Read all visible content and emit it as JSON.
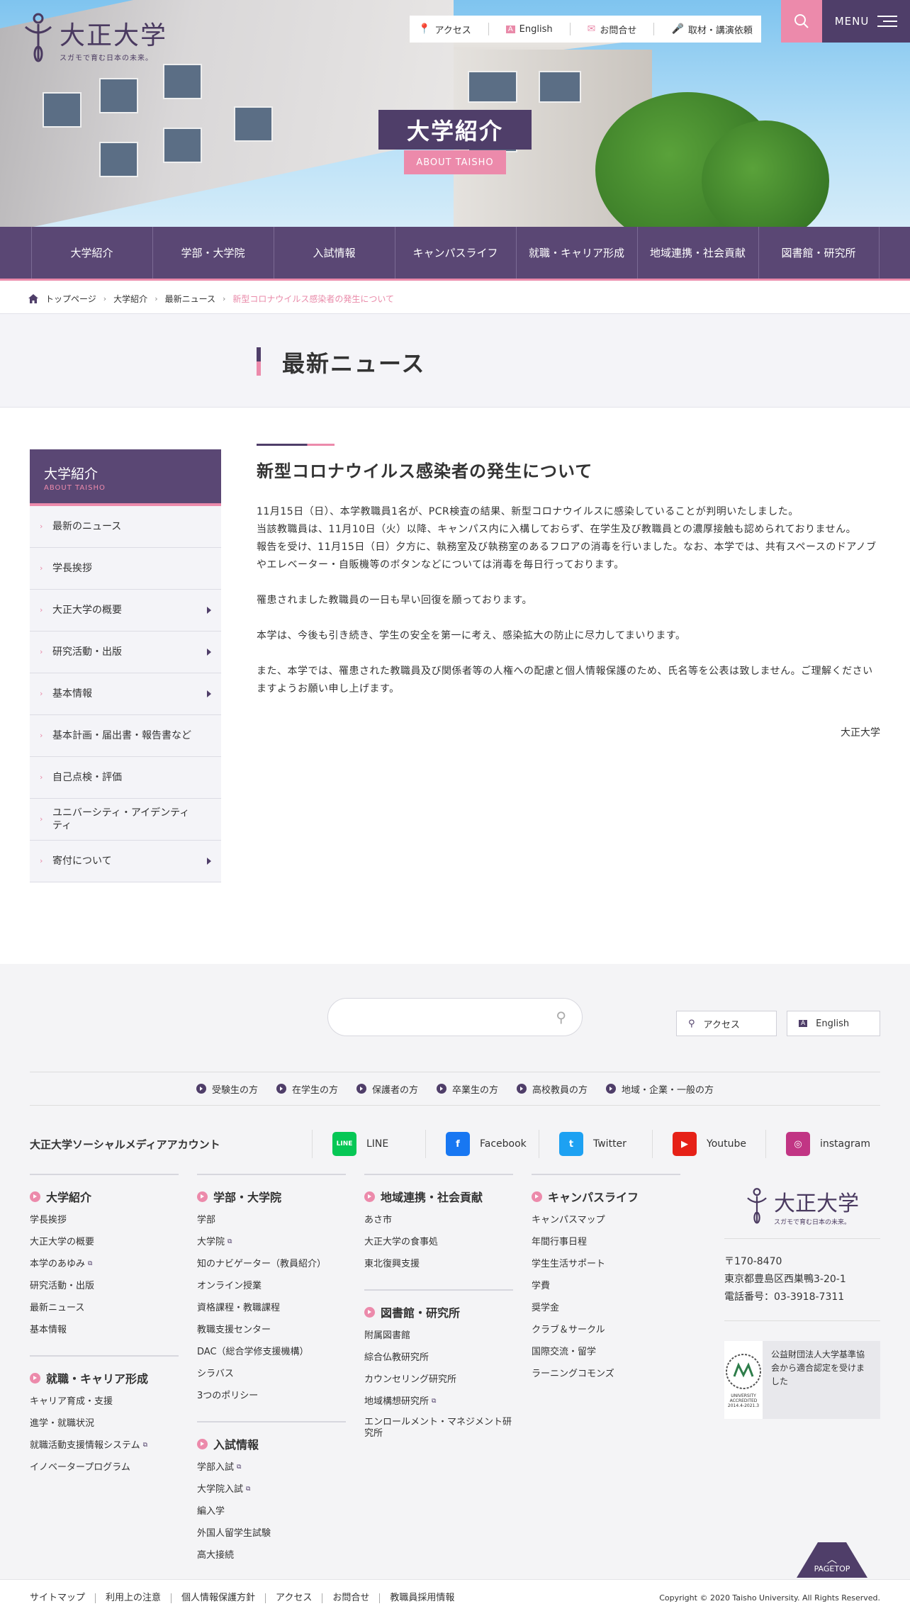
{
  "header": {
    "logo_main": "大正大学",
    "logo_sub": "スガモで育む日本の未来。",
    "topnav": [
      "アクセス",
      "English",
      "お問合せ",
      "取材・講演依頼"
    ],
    "menu_label": "MENU",
    "hero_title": "大学紹介",
    "hero_sub": "ABOUT TAISHO"
  },
  "gnav": [
    "大学紹介",
    "学部・大学院",
    "入試情報",
    "キャンパスライフ",
    "就職・キャリア形成",
    "地域連携・社会貢献",
    "図書館・研究所"
  ],
  "breadcrumb": [
    "トップページ",
    "大学紹介",
    "最新ニュース",
    "新型コロナウイルス感染者の発生について"
  ],
  "page_title": "最新ニュース",
  "sidebar": {
    "title": "大学紹介",
    "subtitle": "ABOUT TAISHO",
    "items": [
      {
        "label": "最新のニュース",
        "expand": false
      },
      {
        "label": "学長挨拶",
        "expand": false
      },
      {
        "label": "大正大学の概要",
        "expand": true
      },
      {
        "label": "研究活動・出版",
        "expand": true
      },
      {
        "label": "基本情報",
        "expand": true
      },
      {
        "label": "基本計画・届出書・報告書など",
        "expand": false
      },
      {
        "label": "自己点検・評価",
        "expand": false
      },
      {
        "label": "ユニバーシティ・アイデンティティ",
        "expand": false
      },
      {
        "label": "寄付について",
        "expand": true
      }
    ]
  },
  "article": {
    "title": "新型コロナウイルス感染者の発生について",
    "paragraphs": [
      "11月15日（日）、本学教職員1名が、PCR検査の結果、新型コロナウイルスに感染していることが判明いたしました。",
      "当該教職員は、11月10日（火）以降、キャンパス内に入構しておらず、在学生及び教職員との濃厚接触も認められておりません。",
      "報告を受け、11月15日（日）夕方に、執務室及び執務室のあるフロアの消毒を行いました。なお、本学では、共有スペースのドアノブやエレベーター・自販機等のボタンなどについては消毒を毎日行っております。",
      "",
      "罹患されました教職員の一日も早い回復を願っております。",
      "",
      "本学は、今後も引き続き、学生の安全を第一に考え、感染拡大の防止に尽力してまいります。",
      "",
      "また、本学では、罹患された教職員及び関係者等の人権への配慮と個人情報保護のため、氏名等を公表は致しません。ご理解くださいますようお願い申し上げます。"
    ],
    "signature": "大正大学"
  },
  "footer": {
    "search_placeholder": "",
    "buttons": [
      "アクセス",
      "English"
    ],
    "audiences": [
      "受験生の方",
      "在学生の方",
      "保護者の方",
      "卒業生の方",
      "高校教員の方",
      "地域・企業・一般の方"
    ],
    "social_title": "大正大学ソーシャルメディアアカウント",
    "social": [
      {
        "name": "LINE",
        "color": "#06c755",
        "icon": "LINE"
      },
      {
        "name": "Facebook",
        "color": "#1877f2",
        "icon": "f"
      },
      {
        "name": "Twitter",
        "color": "#1da1f2",
        "icon": "t"
      },
      {
        "name": "Youtube",
        "color": "#e62117",
        "icon": "▶"
      },
      {
        "name": "instagram",
        "color": "#c13584",
        "icon": "◎"
      }
    ],
    "columns": [
      [
        {
          "title": "大学紹介",
          "links": [
            {
              "t": "学長挨拶"
            },
            {
              "t": "大正大学の概要"
            },
            {
              "t": "本学のあゆみ",
              "ext": true
            },
            {
              "t": "研究活動・出版"
            },
            {
              "t": "最新ニュース"
            },
            {
              "t": "基本情報"
            }
          ]
        },
        {
          "title": "就職・キャリア形成",
          "links": [
            {
              "t": "キャリア育成・支援"
            },
            {
              "t": "進学・就職状況"
            },
            {
              "t": "就職活動支援情報システム",
              "ext": true
            },
            {
              "t": "イノベータープログラム"
            }
          ]
        }
      ],
      [
        {
          "title": "学部・大学院",
          "links": [
            {
              "t": "学部"
            },
            {
              "t": "大学院",
              "ext": true
            },
            {
              "t": "知のナビゲーター（教員紹介）"
            },
            {
              "t": "オンライン授業"
            },
            {
              "t": "資格課程・教職課程"
            },
            {
              "t": "教職支援センター"
            },
            {
              "t": "DAC（総合学修支援機構）"
            },
            {
              "t": "シラバス"
            },
            {
              "t": "3つのポリシー"
            }
          ]
        },
        {
          "title": "入試情報",
          "links": [
            {
              "t": "学部入試",
              "ext": true
            },
            {
              "t": "大学院入試",
              "ext": true
            },
            {
              "t": "編入学"
            },
            {
              "t": "外国人留学生試験"
            },
            {
              "t": "高大接続"
            }
          ]
        }
      ],
      [
        {
          "title": "地域連携・社会貢献",
          "links": [
            {
              "t": "あさ市"
            },
            {
              "t": "大正大学の食事処"
            },
            {
              "t": "東北復興支援"
            }
          ]
        },
        {
          "title": "図書館・研究所",
          "links": [
            {
              "t": "附属図書館"
            },
            {
              "t": "綜合仏教研究所"
            },
            {
              "t": "カウンセリング研究所"
            },
            {
              "t": "地域構想研究所",
              "ext": true
            },
            {
              "t": "エンロールメント・マネジメント研究所",
              "tall": true
            }
          ]
        }
      ],
      [
        {
          "title": "キャンパスライフ",
          "links": [
            {
              "t": "キャンパスマップ"
            },
            {
              "t": "年間行事日程"
            },
            {
              "t": "学生生活サポート"
            },
            {
              "t": "学費"
            },
            {
              "t": "奨学金"
            },
            {
              "t": "クラブ＆サークル"
            },
            {
              "t": "国際交流・留学"
            },
            {
              "t": "ラーニングコモンズ"
            }
          ]
        }
      ]
    ],
    "address": [
      "〒170-8470",
      "東京都豊島区西巣鴨3-20-1",
      "電話番号：03-3918-7311"
    ],
    "accreditation": "公益財団法人大学基準協会から適合認定を受けました",
    "accred_badge": "UNIVERSITY ACCREDITED",
    "accred_years": "2014.4-2021.3",
    "pagetop": "PAGETOP",
    "bottom_links": [
      "サイトマップ",
      "利用上の注意",
      "個人情報保護方針",
      "アクセス",
      "お問合せ",
      "教職員採用情報"
    ],
    "copyright": "Copyright © 2020 Taisho University. All Rights Reserved."
  }
}
